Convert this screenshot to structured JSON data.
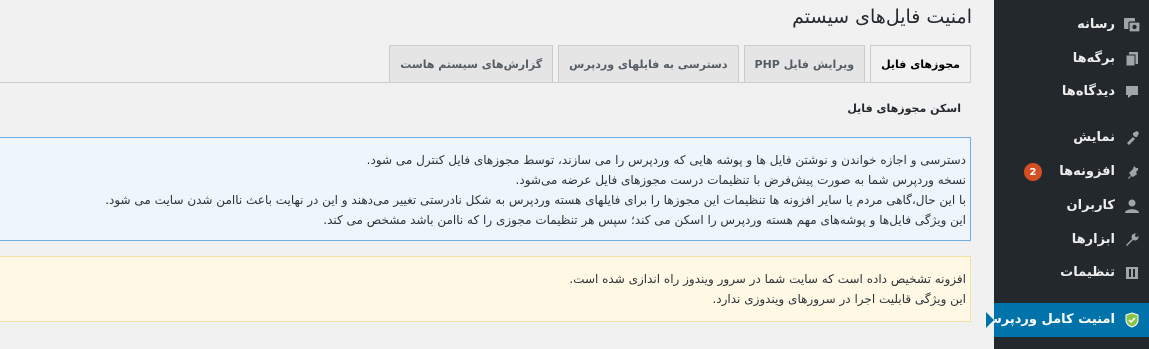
{
  "sidebar": {
    "items": [
      {
        "label": "رسانه",
        "icon": "media-icon"
      },
      {
        "label": "برگه‌ها",
        "icon": "pages-icon"
      },
      {
        "label": "دیدگاه‌ها",
        "icon": "comments-icon"
      },
      {
        "label": "نمایش",
        "icon": "appearance-icon"
      },
      {
        "label": "افزونه‌ها",
        "icon": "plugins-icon",
        "badge": "2"
      },
      {
        "label": "کاربران",
        "icon": "users-icon"
      },
      {
        "label": "ابزارها",
        "icon": "tools-icon"
      },
      {
        "label": "تنظیمات",
        "icon": "settings-icon"
      },
      {
        "label": "امنیت کامل وردپرس",
        "icon": "shield-icon",
        "active": true
      }
    ]
  },
  "page": {
    "title": "امنیت فایل‌های سیستم"
  },
  "tabs": [
    {
      "label": "مجوزهای فایل",
      "active": true
    },
    {
      "label": "ویرایش فایل PHP"
    },
    {
      "label": "دسترسی به فایلهای وردپرس"
    },
    {
      "label": "گزارش‌های سیستم هاست"
    }
  ],
  "section": {
    "title": "اسکن مجوزهای فایل"
  },
  "info_notice": {
    "lines": [
      "دسترسی و اجازه خواندن و نوشتن فایل ها و پوشه هایی که وردپرس را می سازند، توسط مجوزهای فایل کنترل می شود.",
      "نسخه وردپرس شما به صورت پیش‌فرض با تنظیمات درست مجوزهای فایل عرضه می‌شود.",
      "با این حال،گاهی مردم یا سایر افزونه ها تنظیمات این مجوزها را برای فایلهای هسته وردپرس به شکل نادرستی تغییر می‌دهند و این در نهایت باعث ناامن شدن سایت می شود.",
      "این ویژگی فایل‌ها و پوشه‌های مهم هسته وردپرس را اسکن می کند؛ سپس هر تنظیمات مجوزی را که ناامن باشد مشخص می کند."
    ]
  },
  "warning_notice": {
    "lines": [
      "افزونه تشخیص داده است که سایت شما در سرور ویندوز راه اندازی شده است.",
      "این ویژگی قابلیت اجرا در سرورهای ویندوزی ندارد."
    ]
  },
  "colors": {
    "sidebar_bg": "#23282d",
    "active_menu": "#0073aa",
    "badge": "#d54e21",
    "info_border": "#72aee6",
    "warning_bg": "#fff8e5"
  }
}
